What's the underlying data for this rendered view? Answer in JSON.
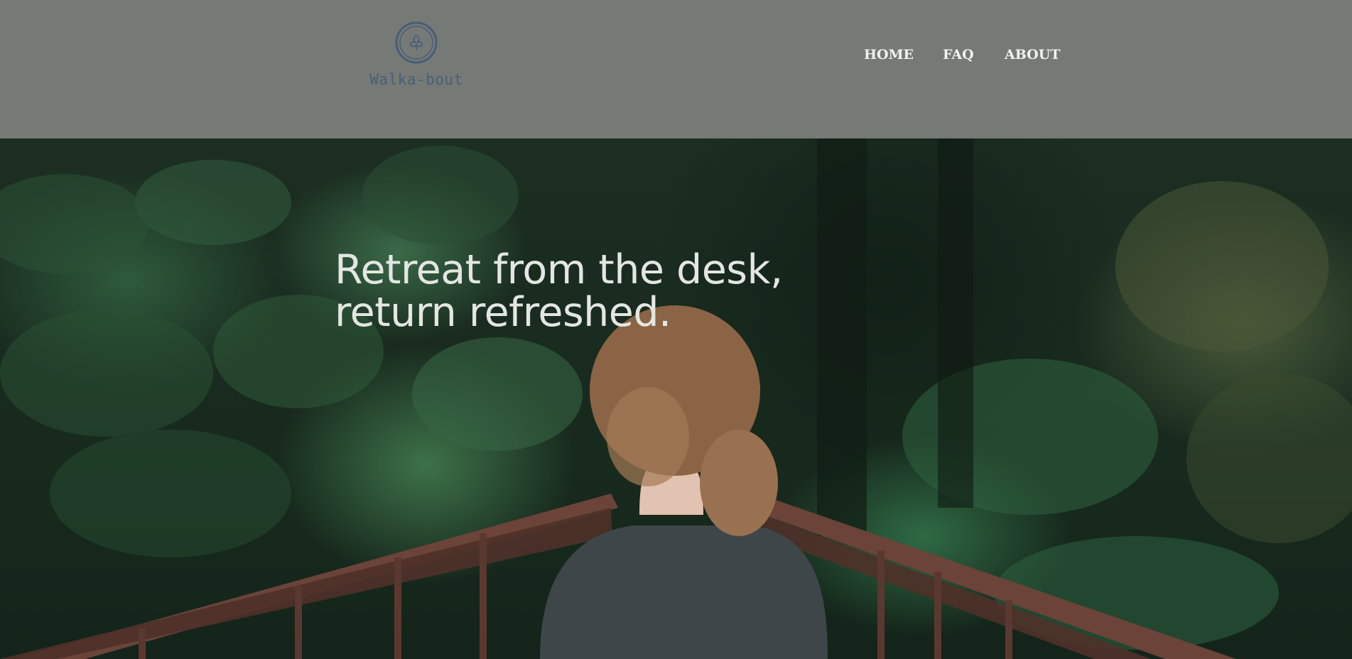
{
  "brand": {
    "name": "Walka-bout",
    "logo_icon": "leaf-emblem-icon",
    "logo_color": "#4a5d78"
  },
  "nav": {
    "items": [
      {
        "label": "HOME"
      },
      {
        "label": "FAQ"
      },
      {
        "label": "ABOUT"
      }
    ]
  },
  "hero": {
    "headline_line1": "Retreat from the desk,",
    "headline_line2": "return refreshed.",
    "background_image": "forest-bridge-photo"
  },
  "colors": {
    "header_bg": "#757a76",
    "nav_text": "#f1f1ee",
    "headline_text": "#e4e6e2"
  }
}
